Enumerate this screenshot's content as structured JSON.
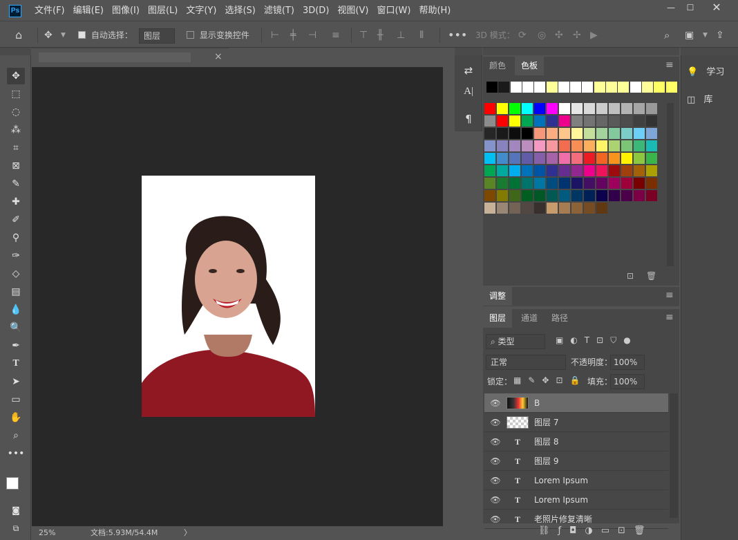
{
  "app": {
    "logo": "Ps"
  },
  "menu": [
    "文件(F)",
    "编辑(E)",
    "图像(I)",
    "图层(L)",
    "文字(Y)",
    "选择(S)",
    "滤镜(T)",
    "3D(D)",
    "视图(V)",
    "窗口(W)",
    "帮助(H)"
  ],
  "options": {
    "auto_select_label": "自动选择：",
    "mode_value": "图层",
    "show_transform_label": "显示变换控件",
    "three_d_label": "3D 模式："
  },
  "doc": {
    "zoom": "25%",
    "doc_info": "文档:5.93M/54.4M"
  },
  "swatches": {
    "tab_color": "颜色",
    "tab_swatches": "色板",
    "recent": [
      "#000000",
      "#1a1a1a",
      "#ffffff",
      "#ffffff",
      "#ffffff",
      "#ffff99",
      "#ffffff",
      "#ffffff",
      "#ffffff",
      "#ffff99",
      "#ffff99",
      "#ffff99",
      "#ffffff",
      "#ffff99",
      "#ffff66",
      "#ffff66"
    ],
    "grid": [
      [
        "#ff0000",
        "#ffff00",
        "#00ff00",
        "#00ffff",
        "#0000ff",
        "#ff00ff",
        "#ffffff",
        "#e6e6e6",
        "#d9d9d9",
        "#cccccc",
        "#bfbfbf",
        "#b3b3b3",
        "#a6a6a6",
        "#999999"
      ],
      [
        "#8c8c8c",
        "#ff0000",
        "#ffff00",
        "#00a651",
        "#0072bc",
        "#2e3192",
        "#ec008c",
        "#808080",
        "#737373",
        "#666666",
        "#595959",
        "#4d4d4d",
        "#404040",
        "#333333"
      ],
      [
        "#262626",
        "#1a1a1a",
        "#0d0d0d",
        "#000000",
        "#f7977a",
        "#f9ad81",
        "#fdc68a",
        "#fff79a",
        "#c4df9b",
        "#a2d39c",
        "#82ca9d",
        "#7bcdc8",
        "#6ecff6",
        "#7ea7d8"
      ],
      [
        "#8493ca",
        "#8882be",
        "#a187be",
        "#bc8dbf",
        "#f49ac2",
        "#f6989d",
        "#f26c4f",
        "#f68e55",
        "#fbaf5c",
        "#fff467",
        "#acd372",
        "#7cc576",
        "#3bb878",
        "#1abbb4"
      ],
      [
        "#00bff3",
        "#438ccb",
        "#5574b9",
        "#605ca8",
        "#855fa8",
        "#a763a8",
        "#f06ea9",
        "#f26d7d",
        "#ed1c24",
        "#f26522",
        "#f7941d",
        "#fff200",
        "#8dc73f",
        "#39b54a"
      ],
      [
        "#00a651",
        "#00a99d",
        "#00aeef",
        "#0072bc",
        "#0054a6",
        "#2e3192",
        "#662d91",
        "#92278f",
        "#ec008c",
        "#ed145b",
        "#9e0b0f",
        "#a0410d",
        "#a36209",
        "#aba000"
      ],
      [
        "#598527",
        "#197b30",
        "#007236",
        "#00746b",
        "#0076a3",
        "#004b80",
        "#003471",
        "#1b1464",
        "#440e62",
        "#630460",
        "#9e005d",
        "#9e0039",
        "#790000",
        "#7b2e00"
      ],
      [
        "#7d4900",
        "#827b00",
        "#406618",
        "#005e20",
        "#005826",
        "#005952",
        "#005b7f",
        "#003663",
        "#002157",
        "#0d004c",
        "#32004b",
        "#4b0049",
        "#7b0046",
        "#7a0026"
      ],
      [
        "#c7b299",
        "#998675",
        "#736357",
        "#534741",
        "#37302d",
        "#c69c6d",
        "#a67c52",
        "#8c6239",
        "#754c24",
        "#603913"
      ]
    ]
  },
  "adjust_label": "调整",
  "layers": {
    "tab_layers": "图层",
    "tab_channels": "通道",
    "tab_paths": "路径",
    "filter_value": "类型",
    "blend_value": "正常",
    "opacity_label": "不透明度：",
    "opacity_value": "100%",
    "lock_label": "锁定：",
    "fill_label": "填充：",
    "fill_value": "100%",
    "list": [
      {
        "name": "B",
        "selected": true,
        "icon": "smart-object"
      },
      {
        "name": "图层 7",
        "selected": false,
        "icon": "transparent"
      },
      {
        "name": "图层 8",
        "selected": false,
        "icon": "text"
      },
      {
        "name": "图层 9",
        "selected": false,
        "icon": "text"
      },
      {
        "name": "Lorem Ipsum",
        "selected": false,
        "icon": "text"
      },
      {
        "name": "Lorem Ipsum",
        "selected": false,
        "icon": "text"
      },
      {
        "name": "老照片修复清晰",
        "selected": false,
        "icon": "text"
      }
    ]
  },
  "dock": {
    "learn": "学习",
    "library": "库"
  }
}
